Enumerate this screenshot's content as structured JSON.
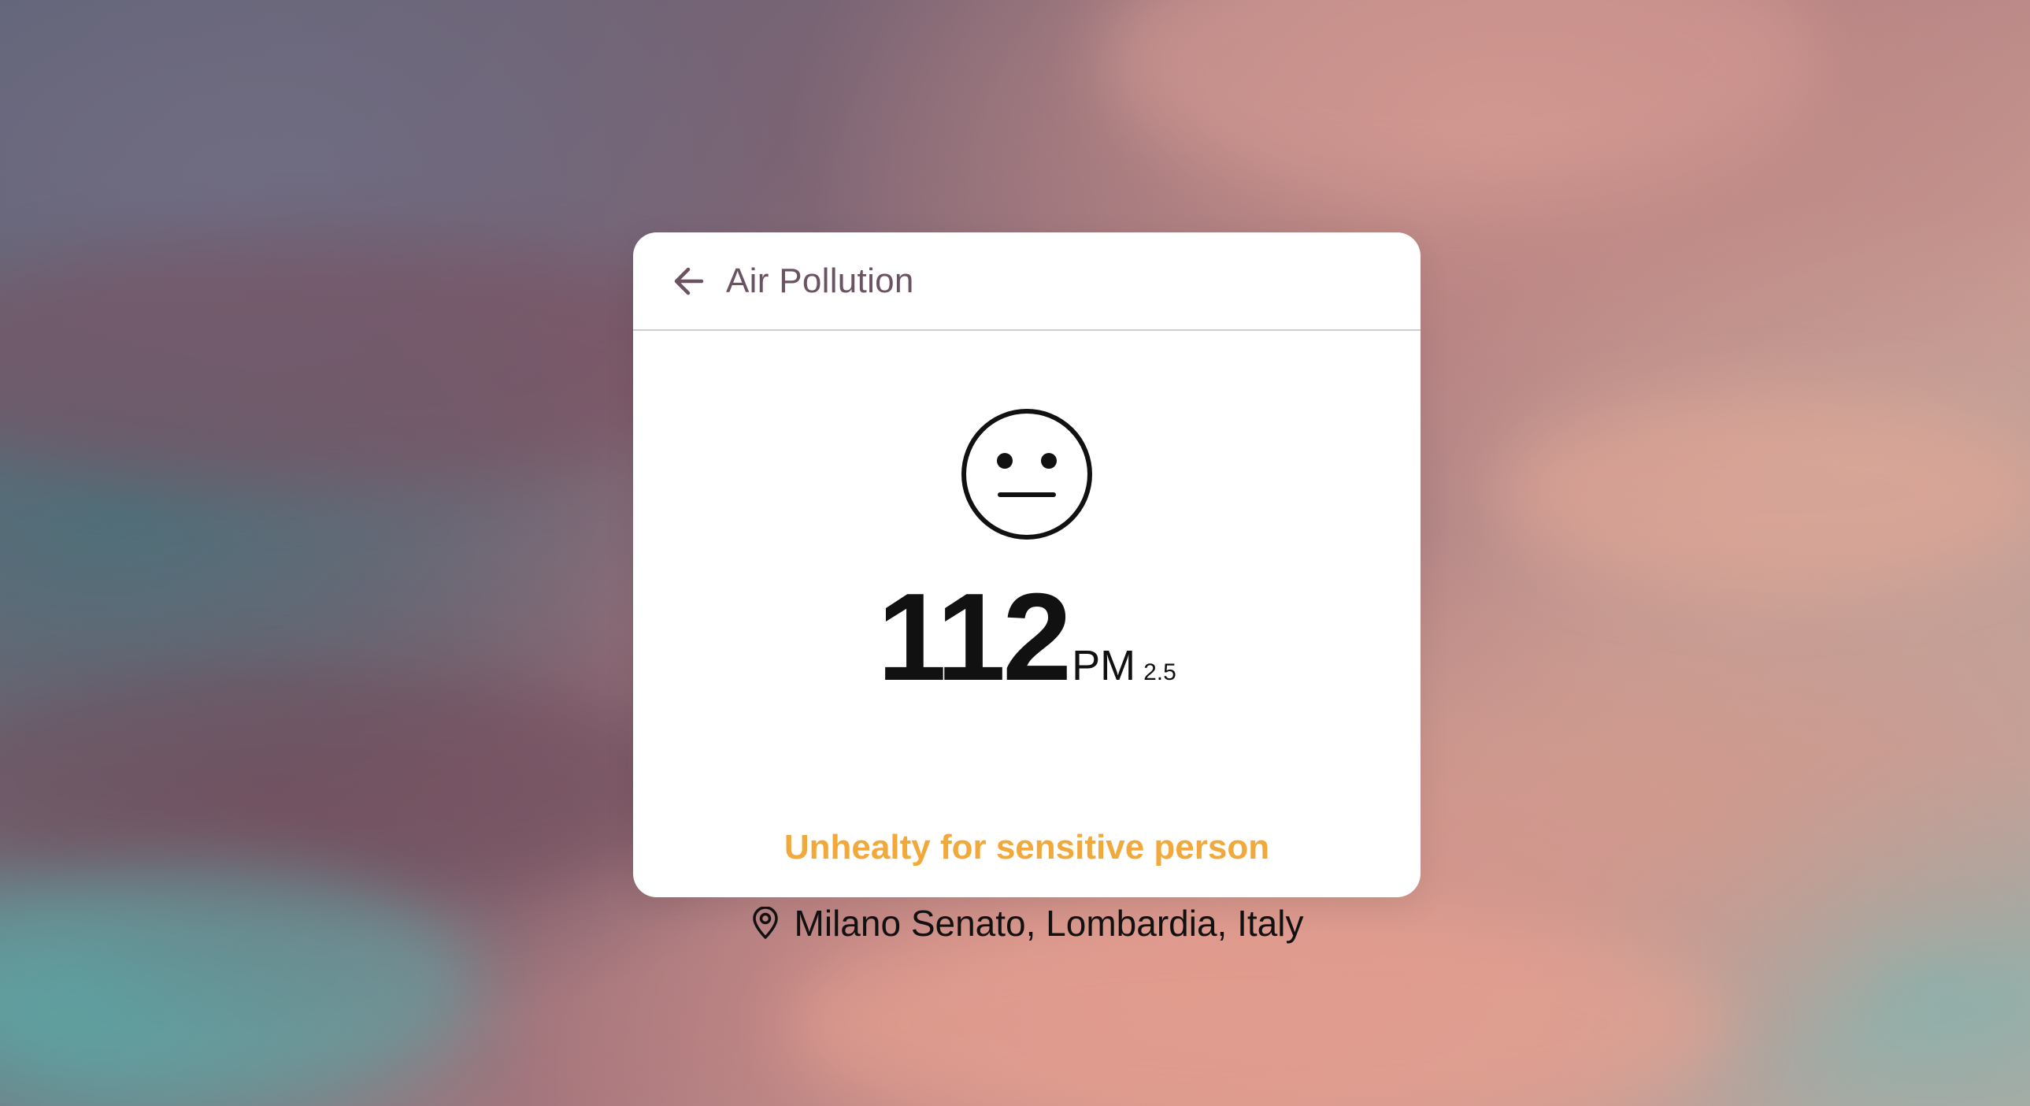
{
  "header": {
    "title": "Air Pollution",
    "back_icon": "arrow-left-icon"
  },
  "reading": {
    "value": "112",
    "unit": "PM",
    "unit_sub": "2.5",
    "face_icon": "neutral-face-icon"
  },
  "status": {
    "label": "Unhealty for sensitive person",
    "color": "#f2a93b"
  },
  "location": {
    "icon": "location-pin-icon",
    "text": "Milano Senato, Lombardia, Italy"
  },
  "colors": {
    "header_text": "#6a5362",
    "card_bg": "#ffffff",
    "value_text": "#111111"
  }
}
